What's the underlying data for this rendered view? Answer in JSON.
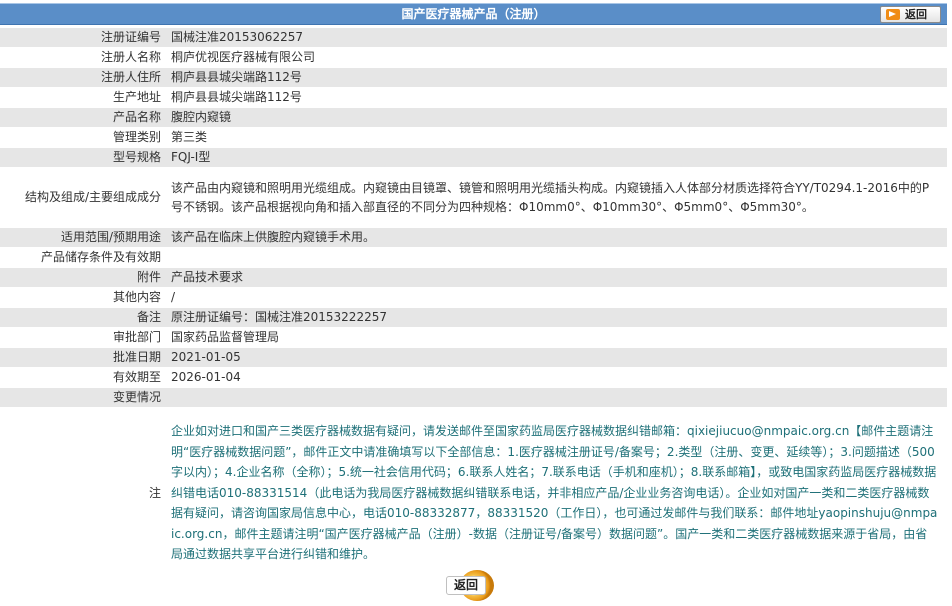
{
  "header": {
    "title": "国产医疗器械产品（注册）",
    "back_label": "返回"
  },
  "rows": [
    {
      "label": "注册证编号",
      "value": "国械注准20153062257"
    },
    {
      "label": "注册人名称",
      "value": "桐庐优视医疗器械有限公司"
    },
    {
      "label": "注册人住所",
      "value": "桐庐县县城尖端路112号"
    },
    {
      "label": "生产地址",
      "value": "桐庐县县城尖端路112号"
    },
    {
      "label": "产品名称",
      "value": "腹腔内窥镜"
    },
    {
      "label": "管理类别",
      "value": "第三类"
    },
    {
      "label": "型号规格",
      "value": "FQJ-I型"
    },
    {
      "label": "结构及组成/主要组成成分",
      "value": "该产品由内窥镜和照明用光缆组成。内窥镜由目镜罩、镜管和照明用光缆插头构成。内窥镜插入人体部分材质选择符合YY/T0294.1-2016中的P号不锈钢。该产品根据视向角和插入部直径的不同分为四种规格：Φ10mm0°、Φ10mm30°、Φ5mm0°、Φ5mm30°。"
    },
    {
      "label": "适用范围/预期用途",
      "value": "该产品在临床上供腹腔内窥镜手术用。"
    },
    {
      "label": "产品储存条件及有效期",
      "value": ""
    },
    {
      "label": "附件",
      "value": "产品技术要求"
    },
    {
      "label": "其他内容",
      "value": "/"
    },
    {
      "label": "备注",
      "value": "原注册证编号：国械注准20153222257"
    },
    {
      "label": "审批部门",
      "value": "国家药品监督管理局"
    },
    {
      "label": "批准日期",
      "value": "2021-01-05"
    },
    {
      "label": "有效期至",
      "value": "2026-01-04"
    },
    {
      "label": "变更情况",
      "value": ""
    }
  ],
  "note": {
    "label": "注",
    "text": "企业如对进口和国产三类医疗器械数据有疑问，请发送邮件至国家药监局医疗器械数据纠错邮箱：qixiejiucuo@nmpaic.org.cn【邮件主题请注明“医疗器械数据问题”，邮件正文中请准确填写以下全部信息：1.医疗器械注册证号/备案号；2.类型（注册、变更、延续等）；3.问题描述（500字以内）；4.企业名称（全称）；5.统一社会信用代码；6.联系人姓名；7.联系电话（手机和座机）；8.联系邮箱】，或致电国家药监局医疗器械数据纠错电话010-88331514（此电话为我局医疗器械数据纠错联系电话，并非相应产品/企业业务咨询电话）。企业如对国产一类和二类医疗器械数据有疑问，请咨询国家局信息中心，电话010-88332877，88331520（工作日），也可通过发邮件与我们联系：邮件地址yaopinshuju@nmpaic.org.cn，邮件主题请注明“国产医疗器械产品（注册）-数据（注册证号/备案号）数据问题”。国产一类和二类医疗器械数据来源于省局，由省局通过数据共享平台进行纠错和维护。"
  },
  "footer": {
    "back_label": "返回"
  },
  "colors": {
    "header_bg": "#5a8ec8",
    "row_alt_bg": "#e6e6e6",
    "note_text": "#1e7078",
    "back_icon": "#f08c14"
  }
}
